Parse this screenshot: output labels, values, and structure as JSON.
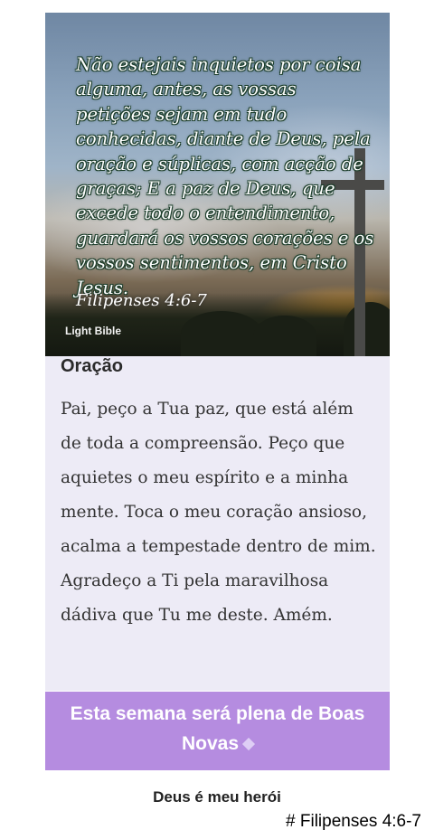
{
  "hero": {
    "verse": "Não estejais inquietos por coisa alguma, antes, as vossas petições sejam em tudo conhecidas, diante de Deus, pela oração e súplicas, com acção de graças; E a paz de Deus, que excede todo o entendimento, guardará os vossos corações e os vossos sentimentos, em Cristo Jesus.",
    "reference": "Filipenses 4:6-7",
    "brand": "Light Bible"
  },
  "prayer": {
    "title": "Oração",
    "text": "Pai, peço a Tua paz, que está além de toda a compreensão. Peço que aquietes o meu espírito e a minha mente. Toca o meu coração ansioso, acalma a tempestade dentro de mim. Agradeço a Ti pela maravilhosa dádiva que Tu me deste. Amém."
  },
  "banner": {
    "text": "Esta semana será plena de Boas Novas"
  },
  "footer": {
    "caption": "Deus é meu herói"
  },
  "hashtag": "# Filipenses 4:6-7",
  "colors": {
    "banner": "#b58ce0",
    "panel": "#edebf6"
  }
}
